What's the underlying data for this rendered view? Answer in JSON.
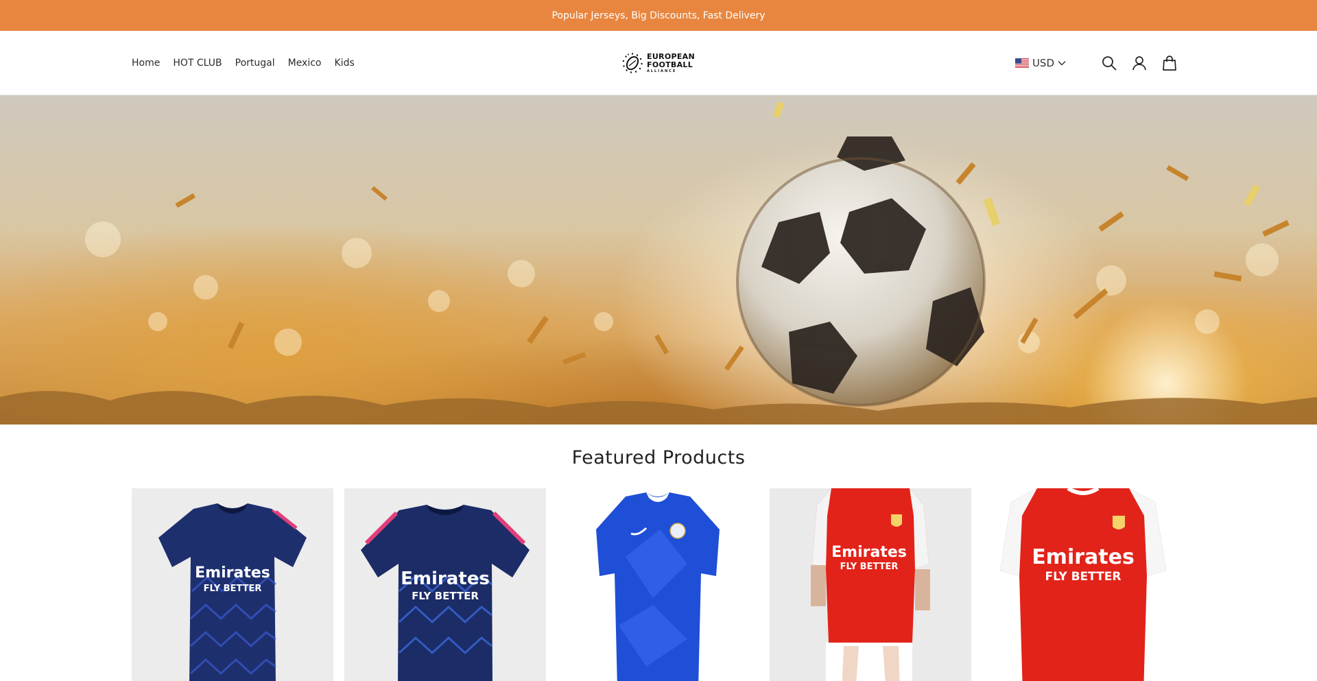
{
  "announcement": {
    "text": "Popular Jerseys, Big Discounts, Fast Delivery"
  },
  "nav": {
    "items": [
      "Home",
      "HOT CLUB",
      "Portugal",
      "Mexico",
      "Kids"
    ]
  },
  "logo": {
    "line1": "EUROPEAN",
    "line2": "FOOTBALL",
    "line3": "ALLIANCE"
  },
  "header": {
    "currency": "USD",
    "icons": [
      "us-flag-icon",
      "chevron-down-icon",
      "search-icon",
      "account-icon",
      "cart-icon"
    ]
  },
  "hero": {
    "image": "soccer-ball-golden-confetti-banner"
  },
  "featured": {
    "title": "Featured Products",
    "products": [
      {
        "image": "navy-jersey-emirates",
        "print": [
          "Emirates",
          "FLY BETTER"
        ]
      },
      {
        "image": "navy-jersey-emirates",
        "print": [
          "Emirates",
          "FLY BETTER"
        ]
      },
      {
        "image": "blue-chelsea-jersey"
      },
      {
        "image": "red-arsenal-jersey-kid",
        "print": [
          "Emirates",
          "FLY BETTER"
        ]
      },
      {
        "image": "red-arsenal-jersey",
        "print": [
          "Emirates",
          "FLY BETTER"
        ]
      }
    ]
  },
  "colors": {
    "announcement_bg": "#e8863f",
    "text": "#222222",
    "navy_kit": "#1e2f6e",
    "chelsea_blue": "#1f4fd6",
    "arsenal_red": "#e2231a"
  }
}
